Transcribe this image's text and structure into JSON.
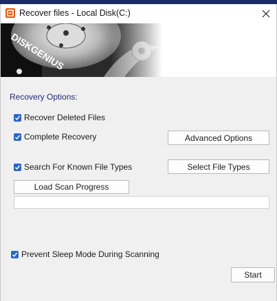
{
  "window": {
    "title": "Recover files - Local Disk(C:)",
    "icons": {
      "app": "diskgenius-app-icon",
      "close": "close-icon"
    }
  },
  "banner": {
    "brand": "DISKGENIUS",
    "image": "hard-disk-platter-illustration"
  },
  "options": {
    "section_label": "Recovery Options:",
    "recover_deleted": {
      "label": "Recover Deleted Files",
      "checked": true
    },
    "complete_recovery": {
      "label": "Complete Recovery",
      "checked": true
    },
    "search_known_types": {
      "label": "Search For Known File Types",
      "checked": true
    },
    "prevent_sleep": {
      "label": "Prevent Sleep Mode During Scanning",
      "checked": true
    }
  },
  "buttons": {
    "advanced_options": "Advanced Options",
    "select_file_types": "Select File Types",
    "load_scan_progress": "Load Scan Progress",
    "start": "Start"
  },
  "progress": {
    "value": 0
  },
  "colors": {
    "accent": "#2968c8",
    "section_label": "#1f2a7a",
    "app_icon": "#e8580c"
  }
}
